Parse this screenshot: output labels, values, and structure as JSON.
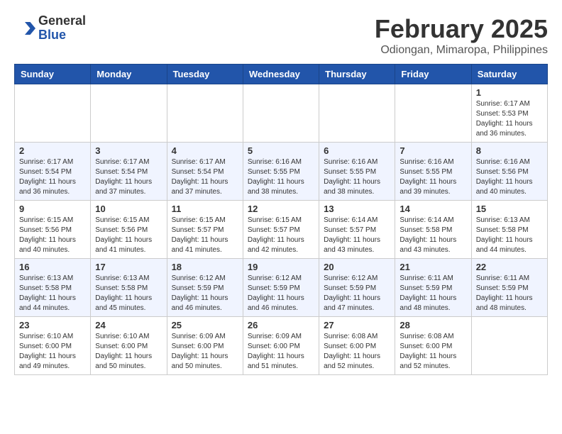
{
  "header": {
    "logo_general": "General",
    "logo_blue": "Blue",
    "title": "February 2025",
    "subtitle": "Odiongan, Mimaropa, Philippines"
  },
  "columns": [
    "Sunday",
    "Monday",
    "Tuesday",
    "Wednesday",
    "Thursday",
    "Friday",
    "Saturday"
  ],
  "weeks": [
    [
      {
        "day": "",
        "info": ""
      },
      {
        "day": "",
        "info": ""
      },
      {
        "day": "",
        "info": ""
      },
      {
        "day": "",
        "info": ""
      },
      {
        "day": "",
        "info": ""
      },
      {
        "day": "",
        "info": ""
      },
      {
        "day": "1",
        "info": "Sunrise: 6:17 AM\nSunset: 5:53 PM\nDaylight: 11 hours\nand 36 minutes."
      }
    ],
    [
      {
        "day": "2",
        "info": "Sunrise: 6:17 AM\nSunset: 5:54 PM\nDaylight: 11 hours\nand 36 minutes."
      },
      {
        "day": "3",
        "info": "Sunrise: 6:17 AM\nSunset: 5:54 PM\nDaylight: 11 hours\nand 37 minutes."
      },
      {
        "day": "4",
        "info": "Sunrise: 6:17 AM\nSunset: 5:54 PM\nDaylight: 11 hours\nand 37 minutes."
      },
      {
        "day": "5",
        "info": "Sunrise: 6:16 AM\nSunset: 5:55 PM\nDaylight: 11 hours\nand 38 minutes."
      },
      {
        "day": "6",
        "info": "Sunrise: 6:16 AM\nSunset: 5:55 PM\nDaylight: 11 hours\nand 38 minutes."
      },
      {
        "day": "7",
        "info": "Sunrise: 6:16 AM\nSunset: 5:55 PM\nDaylight: 11 hours\nand 39 minutes."
      },
      {
        "day": "8",
        "info": "Sunrise: 6:16 AM\nSunset: 5:56 PM\nDaylight: 11 hours\nand 40 minutes."
      }
    ],
    [
      {
        "day": "9",
        "info": "Sunrise: 6:15 AM\nSunset: 5:56 PM\nDaylight: 11 hours\nand 40 minutes."
      },
      {
        "day": "10",
        "info": "Sunrise: 6:15 AM\nSunset: 5:56 PM\nDaylight: 11 hours\nand 41 minutes."
      },
      {
        "day": "11",
        "info": "Sunrise: 6:15 AM\nSunset: 5:57 PM\nDaylight: 11 hours\nand 41 minutes."
      },
      {
        "day": "12",
        "info": "Sunrise: 6:15 AM\nSunset: 5:57 PM\nDaylight: 11 hours\nand 42 minutes."
      },
      {
        "day": "13",
        "info": "Sunrise: 6:14 AM\nSunset: 5:57 PM\nDaylight: 11 hours\nand 43 minutes."
      },
      {
        "day": "14",
        "info": "Sunrise: 6:14 AM\nSunset: 5:58 PM\nDaylight: 11 hours\nand 43 minutes."
      },
      {
        "day": "15",
        "info": "Sunrise: 6:13 AM\nSunset: 5:58 PM\nDaylight: 11 hours\nand 44 minutes."
      }
    ],
    [
      {
        "day": "16",
        "info": "Sunrise: 6:13 AM\nSunset: 5:58 PM\nDaylight: 11 hours\nand 44 minutes."
      },
      {
        "day": "17",
        "info": "Sunrise: 6:13 AM\nSunset: 5:58 PM\nDaylight: 11 hours\nand 45 minutes."
      },
      {
        "day": "18",
        "info": "Sunrise: 6:12 AM\nSunset: 5:59 PM\nDaylight: 11 hours\nand 46 minutes."
      },
      {
        "day": "19",
        "info": "Sunrise: 6:12 AM\nSunset: 5:59 PM\nDaylight: 11 hours\nand 46 minutes."
      },
      {
        "day": "20",
        "info": "Sunrise: 6:12 AM\nSunset: 5:59 PM\nDaylight: 11 hours\nand 47 minutes."
      },
      {
        "day": "21",
        "info": "Sunrise: 6:11 AM\nSunset: 5:59 PM\nDaylight: 11 hours\nand 48 minutes."
      },
      {
        "day": "22",
        "info": "Sunrise: 6:11 AM\nSunset: 5:59 PM\nDaylight: 11 hours\nand 48 minutes."
      }
    ],
    [
      {
        "day": "23",
        "info": "Sunrise: 6:10 AM\nSunset: 6:00 PM\nDaylight: 11 hours\nand 49 minutes."
      },
      {
        "day": "24",
        "info": "Sunrise: 6:10 AM\nSunset: 6:00 PM\nDaylight: 11 hours\nand 50 minutes."
      },
      {
        "day": "25",
        "info": "Sunrise: 6:09 AM\nSunset: 6:00 PM\nDaylight: 11 hours\nand 50 minutes."
      },
      {
        "day": "26",
        "info": "Sunrise: 6:09 AM\nSunset: 6:00 PM\nDaylight: 11 hours\nand 51 minutes."
      },
      {
        "day": "27",
        "info": "Sunrise: 6:08 AM\nSunset: 6:00 PM\nDaylight: 11 hours\nand 52 minutes."
      },
      {
        "day": "28",
        "info": "Sunrise: 6:08 AM\nSunset: 6:00 PM\nDaylight: 11 hours\nand 52 minutes."
      },
      {
        "day": "",
        "info": ""
      }
    ]
  ]
}
